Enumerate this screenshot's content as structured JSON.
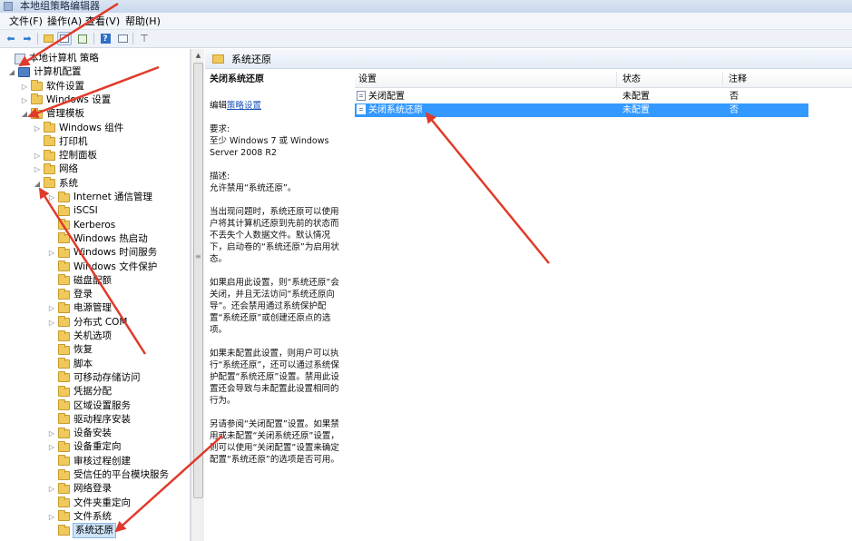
{
  "window": {
    "title": "本地组策略编辑器"
  },
  "menu": [
    {
      "label": "文件(F)"
    },
    {
      "label": "操作(A)"
    },
    {
      "label": "查看(V)"
    },
    {
      "label": "帮助(H)"
    }
  ],
  "toolbar": {
    "buttons": [
      "back-icon",
      "forward-icon",
      "up-folder-icon",
      "show-tree-icon",
      "export-icon",
      "help-icon",
      "properties-icon",
      "filter-icon"
    ]
  },
  "tree": {
    "items": [
      {
        "label": "本地计算机 策略",
        "icon": "policy-icon",
        "toggle": ""
      },
      {
        "label": "计算机配置",
        "icon": "computer-icon",
        "toggle": "◢"
      },
      {
        "label": "软件设置",
        "icon": "folder-icon",
        "toggle": "▷"
      },
      {
        "label": "Windows 设置",
        "icon": "folder-icon",
        "toggle": "▷"
      },
      {
        "label": "管理模板",
        "icon": "folder-icon",
        "toggle": "◢"
      },
      {
        "label": "Windows 组件",
        "icon": "folder-icon",
        "toggle": "▷"
      },
      {
        "label": "打印机",
        "icon": "folder-icon",
        "toggle": ""
      },
      {
        "label": "控制面板",
        "icon": "folder-icon",
        "toggle": "▷"
      },
      {
        "label": "网络",
        "icon": "folder-icon",
        "toggle": "▷"
      },
      {
        "label": "系统",
        "icon": "folder-icon",
        "toggle": "◢"
      },
      {
        "label": "Internet 通信管理",
        "icon": "folder-icon",
        "toggle": "▷"
      },
      {
        "label": "iSCSI",
        "icon": "folder-icon",
        "toggle": ""
      },
      {
        "label": "Kerberos",
        "icon": "folder-icon",
        "toggle": ""
      },
      {
        "label": "Windows 热启动",
        "icon": "folder-icon",
        "toggle": ""
      },
      {
        "label": "Windows 时间服务",
        "icon": "folder-icon",
        "toggle": "▷"
      },
      {
        "label": "Windows 文件保护",
        "icon": "folder-icon",
        "toggle": ""
      },
      {
        "label": "磁盘配额",
        "icon": "folder-icon",
        "toggle": ""
      },
      {
        "label": "登录",
        "icon": "folder-icon",
        "toggle": ""
      },
      {
        "label": "电源管理",
        "icon": "folder-icon",
        "toggle": "▷"
      },
      {
        "label": "分布式 COM",
        "icon": "folder-icon",
        "toggle": "▷"
      },
      {
        "label": "关机选项",
        "icon": "folder-icon",
        "toggle": ""
      },
      {
        "label": "恢复",
        "icon": "folder-icon",
        "toggle": ""
      },
      {
        "label": "脚本",
        "icon": "folder-icon",
        "toggle": ""
      },
      {
        "label": "可移动存储访问",
        "icon": "folder-icon",
        "toggle": ""
      },
      {
        "label": "凭据分配",
        "icon": "folder-icon",
        "toggle": ""
      },
      {
        "label": "区域设置服务",
        "icon": "folder-icon",
        "toggle": ""
      },
      {
        "label": "驱动程序安装",
        "icon": "folder-icon",
        "toggle": ""
      },
      {
        "label": "设备安装",
        "icon": "folder-icon",
        "toggle": "▷"
      },
      {
        "label": "设备重定向",
        "icon": "folder-icon",
        "toggle": "▷"
      },
      {
        "label": "审核过程创建",
        "icon": "folder-icon",
        "toggle": ""
      },
      {
        "label": "受信任的平台模块服务",
        "icon": "folder-icon",
        "toggle": ""
      },
      {
        "label": "网络登录",
        "icon": "folder-icon",
        "toggle": "▷"
      },
      {
        "label": "文件夹重定向",
        "icon": "folder-icon",
        "toggle": ""
      },
      {
        "label": "文件系统",
        "icon": "folder-icon",
        "toggle": "▷"
      },
      {
        "label": "系统还原",
        "icon": "folder-icon",
        "toggle": "",
        "selected": true
      }
    ]
  },
  "detail": {
    "header_title": "系统还原",
    "policy_name": "关闭系统还原",
    "edit_prefix": "编辑",
    "edit_link": "策略设置",
    "requirements_label": "要求:",
    "requirements_text": "至少 Windows 7 或 Windows Server 2008 R2",
    "description_label": "描述:",
    "description_text": "允许禁用“系统还原”。",
    "para1": "当出现问题时，系统还原可以使用户将其计算机还原到先前的状态而不丢失个人数据文件。默认情况下，启动卷的“系统还原”为启用状态。",
    "para2": "如果启用此设置，则“系统还原”会关闭，并且无法访问“系统还原向导”。还会禁用通过系统保护配置“系统还原”或创建还原点的选项。",
    "para3": "如果未配置此设置，则用户可以执行“系统还原”，还可以通过系统保护配置“系统还原”设置。禁用此设置还会导致与未配置此设置相同的行为。",
    "para4": "另请参阅“关闭配置”设置。如果禁用或未配置“关闭系统还原”设置，则可以使用“关闭配置”设置来确定配置“系统还原”的选项是否可用。"
  },
  "list": {
    "columns": [
      "设置",
      "状态",
      "注释"
    ],
    "rows": [
      {
        "setting": "关闭配置",
        "state": "未配置",
        "comment": "否",
        "selected": false
      },
      {
        "setting": "关闭系统还原",
        "state": "未配置",
        "comment": "否",
        "selected": true
      }
    ]
  },
  "colors": {
    "selection": "#3399ff",
    "annotation_arrow": "#e03a2a",
    "link": "#1b55b8"
  }
}
